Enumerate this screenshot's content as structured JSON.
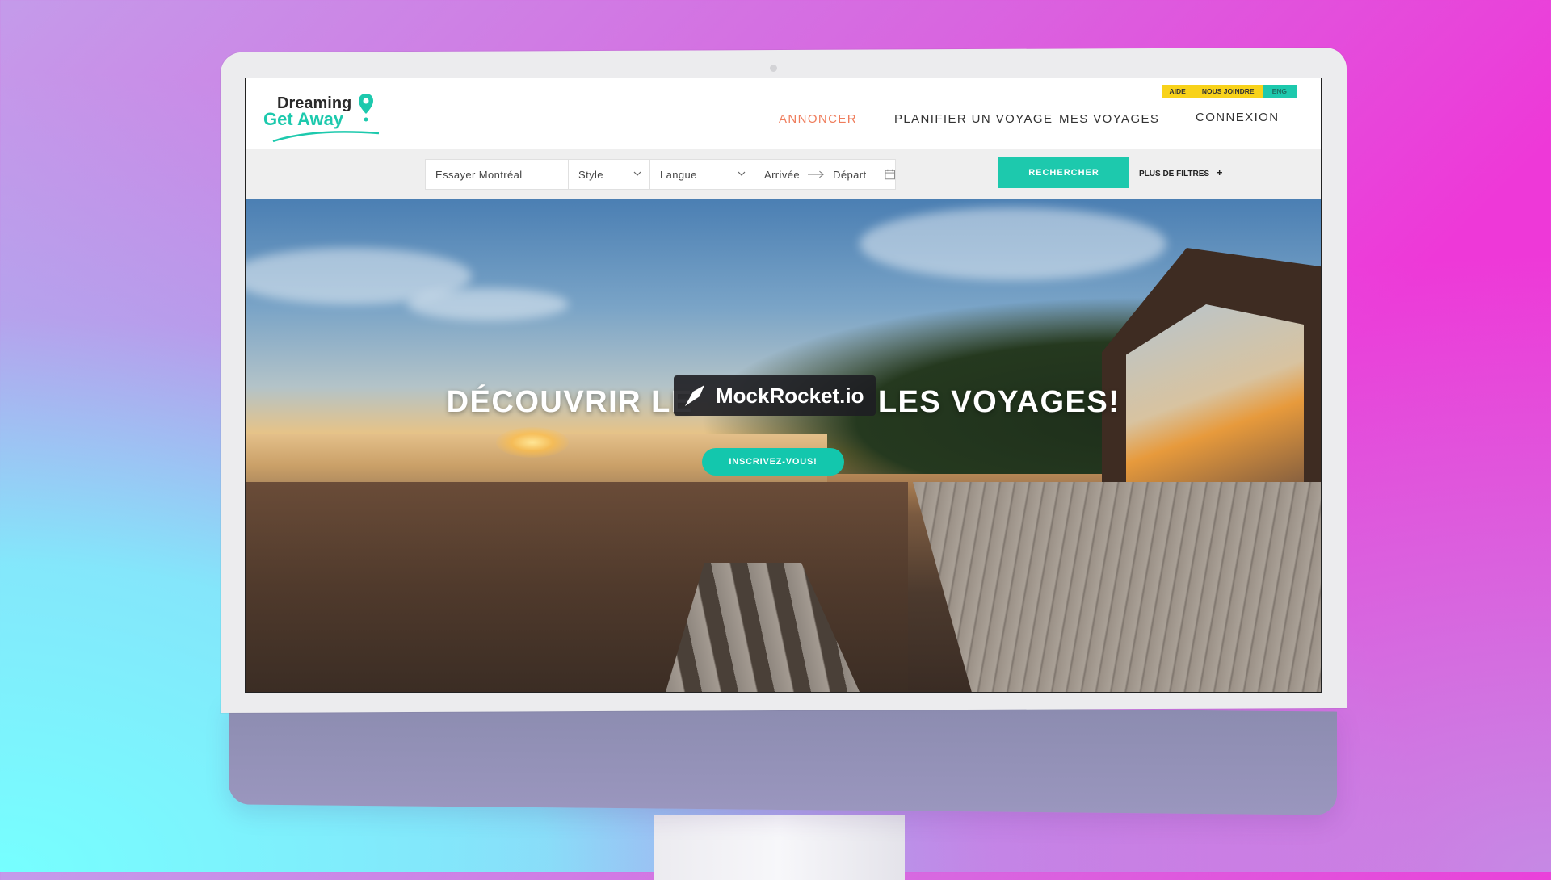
{
  "brand": {
    "logo_line1": "Dreaming",
    "logo_line2": "Get Away",
    "accent": "#1dc9ad",
    "highlight": "#ef7d5c",
    "topbar_yellow": "#f8d21a"
  },
  "topbar": {
    "items": [
      "AIDE",
      "NOUS JOINDRE",
      "ENG"
    ]
  },
  "nav": {
    "items": [
      "ANNONCER",
      "PLANIFIER UN VOYAGE",
      "MES VOYAGES",
      "CONNEXION"
    ],
    "active": "ANNONCER"
  },
  "search": {
    "destination_placeholder": "Essayer Montréal",
    "style_label": "Style",
    "language_label": "Langue",
    "arrival_label": "Arrivée",
    "departure_label": "Départ",
    "submit_label": "RECHERCHER",
    "more_filters_label": "PLUS DE FILTRES",
    "more_filters_icon": "+"
  },
  "hero": {
    "title": "DÉCOUVRIR LE                   LES VOYAGES!",
    "cta_label": "INSCRIVEZ-VOUS!"
  },
  "watermark": {
    "text": "MockRocket.io"
  }
}
